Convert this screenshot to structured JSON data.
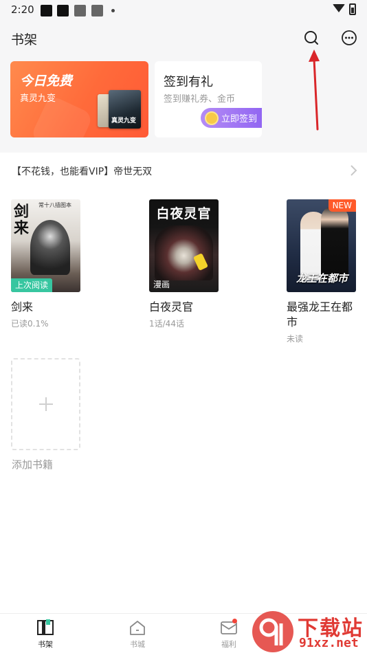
{
  "status_bar": {
    "time": "2:20"
  },
  "header": {
    "title": "书架"
  },
  "banner_free": {
    "title": "今日免费",
    "subtitle": "真灵九变",
    "thumb_text": "真灵九变"
  },
  "banner_sign": {
    "title": "签到有礼",
    "subtitle": "签到赚礼券、金币",
    "button": "立即签到"
  },
  "promo": {
    "text": "【不花钱，也能看VIP】帝世无双"
  },
  "books": [
    {
      "title": "剑来",
      "meta": "已读0.1%",
      "tag": "上次阅读",
      "cover_big": "剑来",
      "cover_small": "常十八插图本"
    },
    {
      "title": "白夜灵官",
      "meta": "1话/44话",
      "tag": "漫画",
      "cover_title": "白夜灵官"
    },
    {
      "title": "最强龙王在都市",
      "meta": "未读",
      "tag": "NEW",
      "cover_title": "龙王在都市"
    }
  ],
  "add_book": {
    "label": "添加书籍"
  },
  "tabs": [
    {
      "label": "书架",
      "icon": "bookshelf-icon",
      "active": true
    },
    {
      "label": "书城",
      "icon": "home-icon",
      "active": false
    },
    {
      "label": "福利",
      "icon": "mail-icon",
      "active": false
    }
  ],
  "watermark": {
    "big": "下载站",
    "small": "91xz.net"
  },
  "colors": {
    "accent_green": "#37c6a0",
    "free_orange": "#ff6a3a",
    "sign_purple": "#8f63f2",
    "new_red": "#ff5a2a",
    "arrow_red": "#d9262a"
  }
}
